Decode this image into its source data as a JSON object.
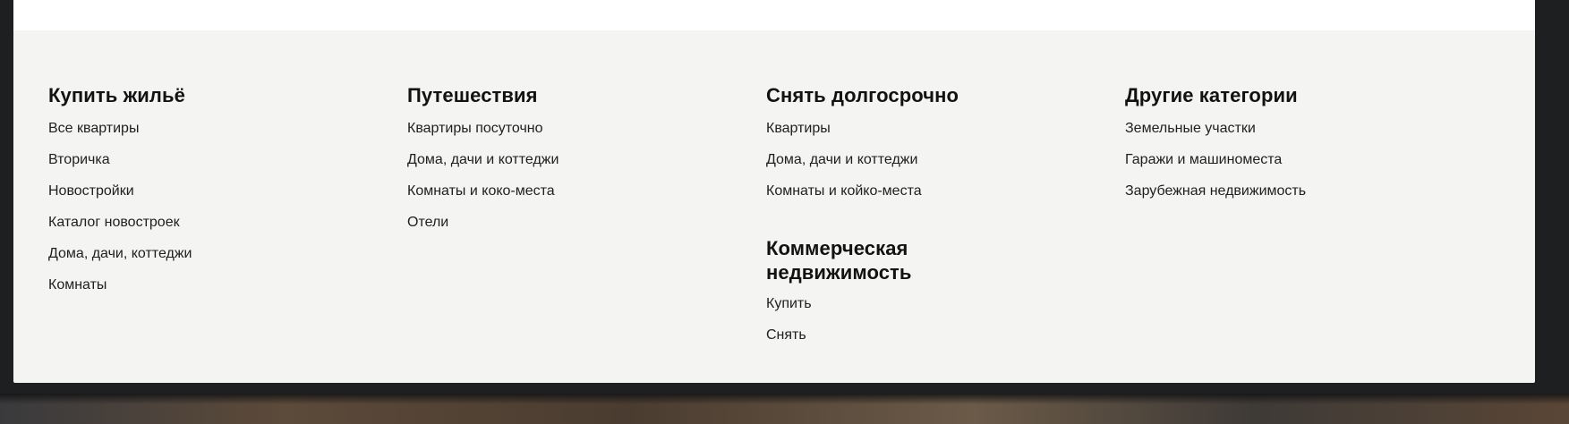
{
  "footer": {
    "columns": [
      {
        "heading": "Купить жильё",
        "links": [
          "Все квартиры",
          "Вторичка",
          "Новостройки",
          "Каталог новостроек",
          "Дома, дачи, коттеджи",
          "Комнаты"
        ]
      },
      {
        "heading": "Путешествия",
        "links": [
          "Квартиры посуточно",
          "Дома, дачи и коттеджи",
          "Комнаты и коко-места",
          "Отели"
        ]
      },
      {
        "heading": "Снять долгосрочно",
        "links": [
          "Квартиры",
          "Дома, дачи и коттеджи",
          "Комнаты и койко-места"
        ],
        "sub_heading": "Коммерческая недвижимость",
        "sub_links": [
          "Купить",
          "Снять"
        ]
      },
      {
        "heading": "Другие категории",
        "links": [
          "Земельные участки",
          "Гаражи и машиноместа",
          "Зарубежная недвижимость"
        ]
      }
    ]
  }
}
